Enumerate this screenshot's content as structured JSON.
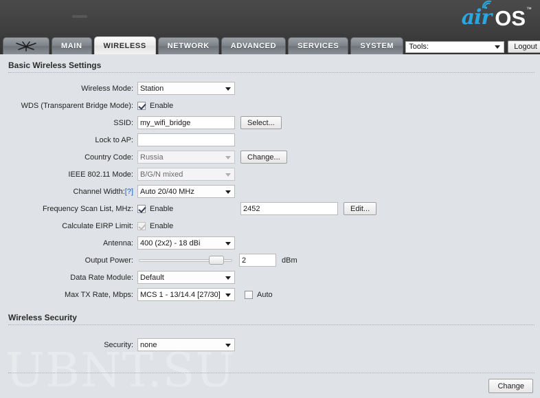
{
  "header": {
    "logo_air": "air",
    "logo_os": "OS",
    "logo_tm": "™"
  },
  "nav": {
    "tabs": [
      {
        "label": "",
        "name": "tab-home",
        "active": false
      },
      {
        "label": "MAIN",
        "name": "tab-main",
        "active": false
      },
      {
        "label": "WIRELESS",
        "name": "tab-wireless",
        "active": true
      },
      {
        "label": "NETWORK",
        "name": "tab-network",
        "active": false
      },
      {
        "label": "ADVANCED",
        "name": "tab-advanced",
        "active": false
      },
      {
        "label": "SERVICES",
        "name": "tab-services",
        "active": false
      },
      {
        "label": "SYSTEM",
        "name": "tab-system",
        "active": false
      }
    ],
    "tools_label": "Tools:",
    "logout_label": "Logout"
  },
  "sections": {
    "basic": "Basic Wireless Settings",
    "security": "Wireless Security"
  },
  "fields": {
    "wireless_mode": {
      "label": "Wireless Mode:",
      "value": "Station"
    },
    "wds": {
      "label": "WDS (Transparent Bridge Mode):",
      "checkbox_label": "Enable",
      "checked": true
    },
    "ssid": {
      "label": "SSID:",
      "value": "my_wifi_bridge",
      "button": "Select..."
    },
    "lock_to_ap": {
      "label": "Lock to AP:",
      "value": "",
      "placeholder": ""
    },
    "country_code": {
      "label": "Country Code:",
      "value": "Russia",
      "button": "Change..."
    },
    "ieee_mode": {
      "label": "IEEE 802.11 Mode:",
      "value": "B/G/N mixed"
    },
    "channel_width": {
      "label": "Channel Width:",
      "help": "[?]",
      "value": "Auto 20/40 MHz"
    },
    "freq_scan_list": {
      "label": "Frequency Scan List, MHz:",
      "checkbox_label": "Enable",
      "checked": true,
      "value": "2452",
      "button": "Edit..."
    },
    "calc_eirp": {
      "label": "Calculate EIRP Limit:",
      "checkbox_label": "Enable",
      "checked": true,
      "disabled": true
    },
    "antenna": {
      "label": "Antenna:",
      "value": "400 (2x2) - 18 dBi"
    },
    "output_power": {
      "label": "Output Power:",
      "value": "2",
      "unit": "dBm",
      "slider_percent": 88
    },
    "data_rate_module": {
      "label": "Data Rate Module:",
      "value": "Default"
    },
    "max_tx_rate": {
      "label": "Max TX Rate, Mbps:",
      "value": "MCS 1 - 13/14.4 [27/30]",
      "auto_label": "Auto",
      "auto_checked": false
    },
    "security": {
      "label": "Security:",
      "value": "none"
    }
  },
  "footer": {
    "change_label": "Change"
  },
  "watermark": "UBNT.SU"
}
